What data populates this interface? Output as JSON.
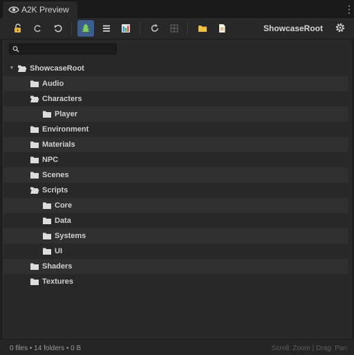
{
  "tab": {
    "title": "A2K Preview",
    "icon": "eye-icon"
  },
  "toolbar": {
    "buttons": [
      "unlock-icon",
      "ring-icon",
      "undo-icon",
      "tree-view-icon",
      "list-view-icon",
      "columns-view-icon",
      "refresh-icon",
      "grid-icon",
      "folder-icon",
      "file-icon"
    ],
    "root_title": "ShowcaseRoot",
    "accent": "#3d5e8c"
  },
  "search": {
    "placeholder": "",
    "value": ""
  },
  "tree": {
    "root": "ShowcaseRoot",
    "items": [
      {
        "label": "Audio"
      },
      {
        "label": "Characters"
      },
      {
        "label": "Player"
      },
      {
        "label": "Environment"
      },
      {
        "label": "Materials"
      },
      {
        "label": "NPC"
      },
      {
        "label": "Scenes"
      },
      {
        "label": "Scripts"
      },
      {
        "label": "Core"
      },
      {
        "label": "Data"
      },
      {
        "label": "Systems"
      },
      {
        "label": "UI"
      },
      {
        "label": "Shaders"
      },
      {
        "label": "Textures"
      }
    ]
  },
  "status": {
    "summary": "0 files • 14 folders • 0 B",
    "hint": "Scroll: Zoom | Drag: Pan"
  }
}
